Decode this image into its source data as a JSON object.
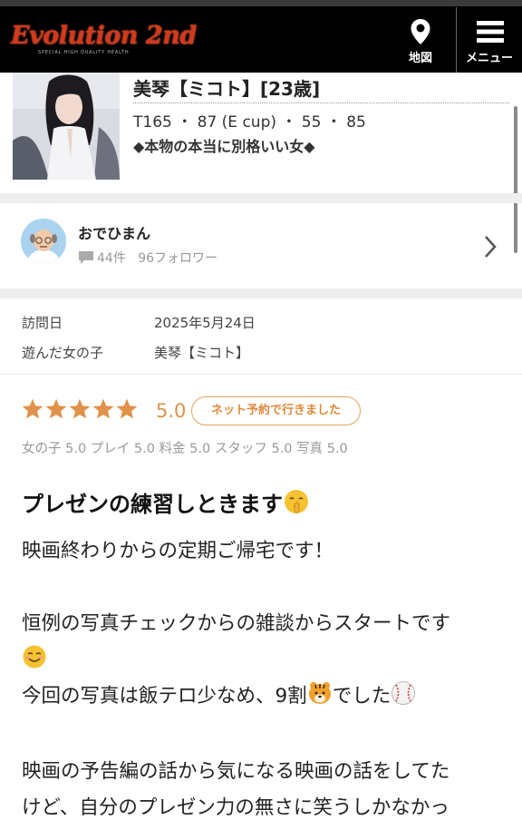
{
  "header": {
    "logo_text": "Evolution 2nd",
    "logo_tagline": "SPECIAL HIGH QUALITY HEALTH",
    "map_label": "地図",
    "menu_label": "メニュー"
  },
  "profile": {
    "name": "美琴【ミコト】[23歳]",
    "stats": "T165 ・ 87 (E cup) ・ 55 ・ 85",
    "catchphrase": "◆本物の本当に別格いい女◆"
  },
  "reviewer": {
    "name": "おでひまん",
    "reviews": "44件",
    "followers": "96フォロワー"
  },
  "visit": {
    "date_label": "訪問日",
    "date_value": "2025年5月24日",
    "girl_label": "遊んだ女の子",
    "girl_value": "美琴【ミコト】"
  },
  "rating": {
    "stars": 5,
    "score": "5.0",
    "badge": "ネット予約で行きました",
    "subscores": "女の子 5.0 プレイ 5.0 料金 5.0 スタッフ 5.0 写真 5.0"
  },
  "review": {
    "title": "プレゼンの練習しときます",
    "line1": "映画終わりからの定期ご帰宅です！",
    "line2": "恒例の写真チェックからの雑談からスタートです",
    "line3a": "今回の写真は飯テロ少なめ、9割",
    "line3b": "でした",
    "line4": "映画の予告編の話から気になる映画の話をしてた",
    "line5": "けど、自分のプレゼン力の無さに笑うしかなかっ"
  },
  "colors": {
    "header_bg": "#000000",
    "logo_red": "#d23a1e",
    "accent_orange": "#e0924a",
    "separator": "#eeeeee",
    "avatar_bg": "#a9d3ef"
  }
}
